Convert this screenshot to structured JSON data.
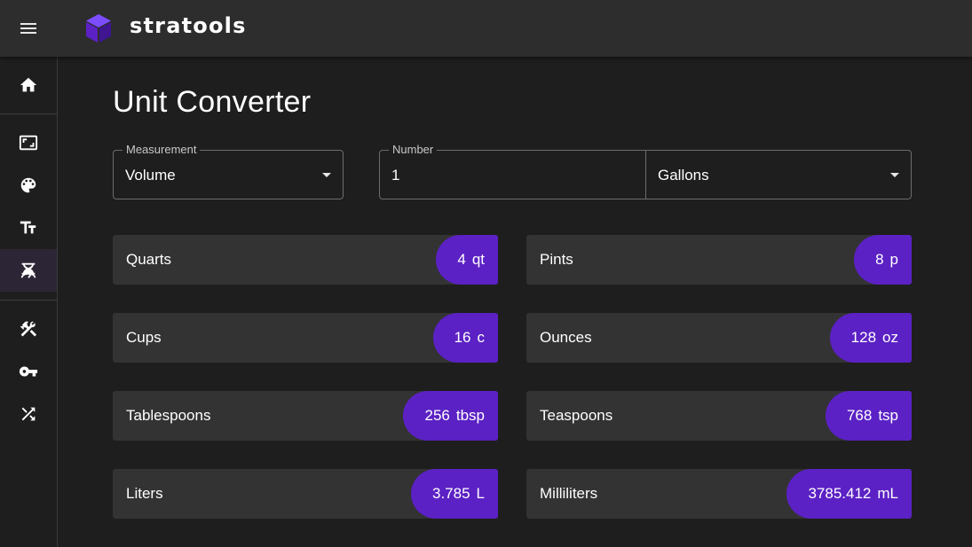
{
  "app": {
    "brand": "stratools",
    "brand_color": "#5b21c4"
  },
  "header": {
    "menu_icon": "hamburger-menu-icon",
    "logo_icon": "cube-logo-icon"
  },
  "sidebar": {
    "items": [
      {
        "name": "home",
        "icon": "home-icon",
        "active": false
      },
      {
        "name": "aspect-ratio",
        "icon": "aspect-ratio-icon",
        "active": false
      },
      {
        "name": "colors",
        "icon": "palette-icon",
        "active": false
      },
      {
        "name": "typography",
        "icon": "text-size-icon",
        "active": false
      },
      {
        "name": "unit-converter",
        "icon": "converter-icon",
        "active": true
      },
      {
        "name": "design-tools",
        "icon": "tools-icon",
        "active": false
      },
      {
        "name": "passwords",
        "icon": "key-icon",
        "active": false
      },
      {
        "name": "randomizer",
        "icon": "shuffle-icon",
        "active": false
      }
    ]
  },
  "page": {
    "title": "Unit Converter"
  },
  "form": {
    "measurement_label": "Measurement",
    "measurement_value": "Volume",
    "number_label": "Number",
    "number_value": "1",
    "unit_value": "Gallons"
  },
  "results": [
    {
      "label": "Quarts",
      "value": "4",
      "unit": "qt"
    },
    {
      "label": "Pints",
      "value": "8",
      "unit": "p"
    },
    {
      "label": "Cups",
      "value": "16",
      "unit": "c"
    },
    {
      "label": "Ounces",
      "value": "128",
      "unit": "oz"
    },
    {
      "label": "Tablespoons",
      "value": "256",
      "unit": "tbsp"
    },
    {
      "label": "Teaspoons",
      "value": "768",
      "unit": "tsp"
    },
    {
      "label": "Liters",
      "value": "3.785",
      "unit": "L"
    },
    {
      "label": "Milliliters",
      "value": "3785.412",
      "unit": "mL"
    }
  ]
}
